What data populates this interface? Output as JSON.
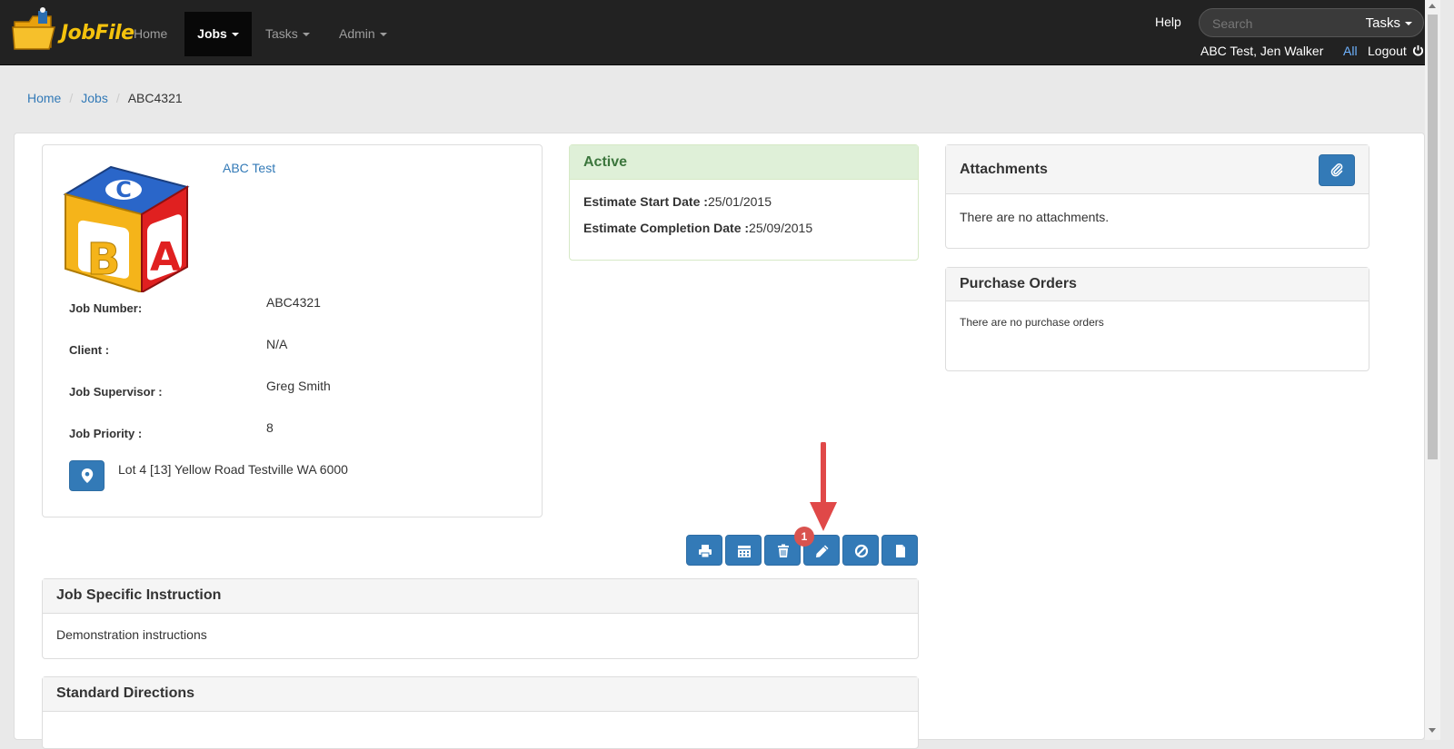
{
  "navbar": {
    "logo_text": "JobFile",
    "items": [
      {
        "label": "Home",
        "active": false
      },
      {
        "label": "Jobs",
        "active": true
      },
      {
        "label": "Tasks",
        "active": false
      },
      {
        "label": "Admin",
        "active": false
      }
    ],
    "help": "Help",
    "search_placeholder": "Search",
    "search_scope": "Tasks",
    "user": "ABC Test, Jen Walker",
    "all_link": "All",
    "logout": "Logout"
  },
  "breadcrumb": {
    "home": "Home",
    "jobs": "Jobs",
    "current": "ABC4321"
  },
  "job": {
    "client_link": "ABC Test",
    "fields": [
      {
        "label": "Job Number:",
        "value": "ABC4321"
      },
      {
        "label": "Client :",
        "value": "N/A"
      },
      {
        "label": "Job Supervisor :",
        "value": "Greg Smith"
      },
      {
        "label": "Job Priority :",
        "value": "8"
      }
    ],
    "address": "Lot 4 [13] Yellow Road Testville WA 6000"
  },
  "status": {
    "title": "Active",
    "start_label": "Estimate Start Date :",
    "start_value": "25/01/2015",
    "completion_label": "Estimate Completion Date :",
    "completion_value": "25/09/2015"
  },
  "attachments": {
    "title": "Attachments",
    "empty": "There are no attachments."
  },
  "purchase_orders": {
    "title": "Purchase Orders",
    "empty": "There are no purchase orders"
  },
  "actions": {
    "badge": "1",
    "icons": [
      "print-icon",
      "calendar-icon",
      "trash-icon",
      "pencil-icon",
      "ban-icon",
      "file-icon"
    ]
  },
  "instructions": {
    "title": "Job Specific Instruction",
    "body": "Demonstration instructions"
  },
  "directions": {
    "title": "Standard Directions"
  },
  "colors": {
    "navbar": "#222222",
    "primary": "#337ab7",
    "success_bg": "#dff0d8",
    "success_text": "#3c763d",
    "danger": "#d9534f"
  }
}
